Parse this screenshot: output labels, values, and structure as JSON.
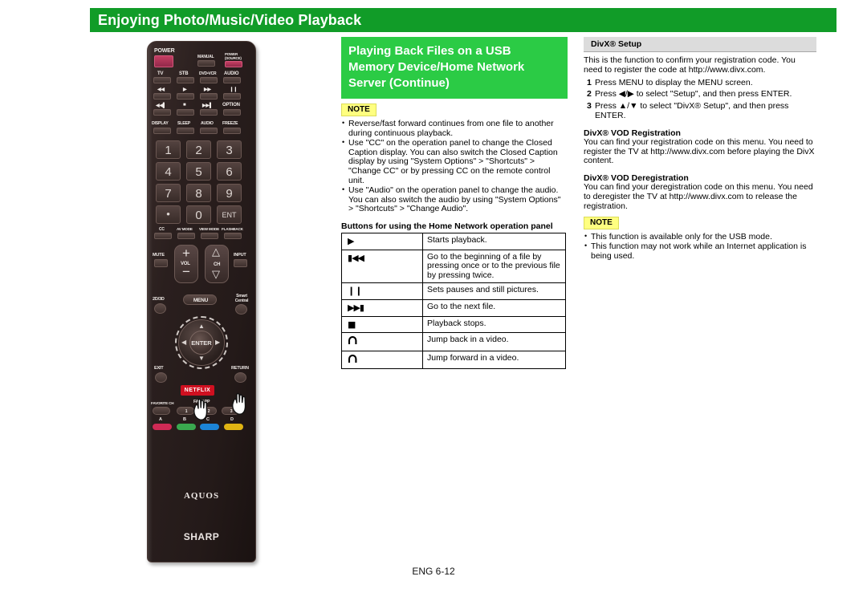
{
  "banner": {
    "title": "Enjoying Photo/Music/Video Playback"
  },
  "middle": {
    "subhead": "Playing Back Files on a USB Memory Device/Home Network Server (Continue)",
    "note_label": "NOTE",
    "notes": [
      "Reverse/fast forward continues from one file to another during continuous playback.",
      "Use \"CC\" on the operation panel to change the Closed Caption display. You can also switch the Closed Caption display by using \"System Options\" > \"Shortcuts\" > \"Change CC\" or by pressing CC on the remote control unit.",
      "Use \"Audio\" on the operation panel to change the audio. You can also switch the audio by using \"System Options\" > \"Shortcuts\" > \"Change Audio\"."
    ],
    "table_heading": "Buttons for using the Home Network operation panel",
    "table_rows": [
      {
        "icon": "play-icon",
        "glyph": "▶",
        "desc": "Starts playback."
      },
      {
        "icon": "previous-icon",
        "glyph": "◀◀",
        "desc": "Go to the beginning of a file by pressing once or to the previous file by pressing twice."
      },
      {
        "icon": "pause-icon",
        "glyph": "❙❙",
        "desc": "Sets pauses and still pictures."
      },
      {
        "icon": "next-icon",
        "glyph": "▶▶",
        "desc": "Go to the next file."
      },
      {
        "icon": "stop-icon",
        "glyph": "■",
        "desc": "Playback stops."
      },
      {
        "icon": "jump-back-icon",
        "glyph": "⌢",
        "desc": "Jump back in a video."
      },
      {
        "icon": "jump-forward-icon",
        "glyph": "⌢",
        "desc": "Jump forward in a video."
      }
    ]
  },
  "right": {
    "panel_title": "DivX® Setup",
    "intro": "This is the function to confirm your registration code. You need to register the code at http://www.divx.com.",
    "steps": [
      {
        "num": "1",
        "text": "Press MENU to display the MENU screen."
      },
      {
        "num": "2",
        "text": "Press ◀/▶ to select \"Setup\", and then press ENTER."
      },
      {
        "num": "3",
        "text": "Press ▲/▼ to select \"DivX® Setup\", and then press ENTER."
      }
    ],
    "sections": [
      {
        "title": "DivX® VOD Registration",
        "body": "You can find your registration code on this menu. You need to register the TV at http://www.divx.com before playing the DivX content."
      },
      {
        "title": "DivX® VOD Deregistration",
        "body": "You can find your deregistration code on this menu. You need to deregister the TV at http://www.divx.com to release the registration."
      }
    ],
    "note_label": "NOTE",
    "notes": [
      "This function is available only for the USB mode.",
      "This function may not work while an Internet application is being used."
    ]
  },
  "remote": {
    "labels": {
      "power": "POWER",
      "manual": "MANUAL",
      "power_source": "POWER (SOURCE)",
      "tv": "TV",
      "stb": "STB",
      "dvd_vcr": "DVD•VCR",
      "audio_top": "AUDIO",
      "rew": "◀◀",
      "play": "▶",
      "ff": "▶▶",
      "pause": "❙❙",
      "prev": "◀◀▌",
      "stop": "■",
      "next": "▶▶▌",
      "option": "OPTION",
      "display": "DISPLAY",
      "sleep": "SLEEP",
      "audio": "AUDIO",
      "freeze": "FREEZE",
      "cc": "CC",
      "av_mode": "AV MODE",
      "view_mode": "VIEW MODE",
      "flashback": "FLASHBACK",
      "mute": "MUTE",
      "vol": "VOL",
      "ch": "CH",
      "input": "INPUT",
      "twod_threed": "2D/3D",
      "menu": "MENU",
      "smart_central": "Smart Central",
      "enter": "ENTER",
      "exit": "EXIT",
      "return": "RETURN",
      "netflix": "NETFLIX",
      "favorite_ch": "FAVORITE CH",
      "fav_app": "FAV APP",
      "brand_aquos": "AQUOS",
      "brand_sharp": "SHARP"
    },
    "numbers": [
      "1",
      "2",
      "3",
      "4",
      "5",
      "6",
      "7",
      "8",
      "9",
      "•",
      "0",
      "ENT"
    ],
    "fav_app_nums": [
      "1",
      "2",
      "3"
    ],
    "color_buttons": [
      {
        "label": "A",
        "color": "#cf2a55"
      },
      {
        "label": "B",
        "color": "#3aa84f"
      },
      {
        "label": "C",
        "color": "#1c84d6"
      },
      {
        "label": "D",
        "color": "#e0b413"
      }
    ]
  },
  "footer": {
    "page_text": "ENG 6-12"
  },
  "colors": {
    "banner_green": "#119c28",
    "subhead_green": "#2bcb45",
    "note_yellow": "#ffff80",
    "panel_gray": "#dcdcdc"
  }
}
